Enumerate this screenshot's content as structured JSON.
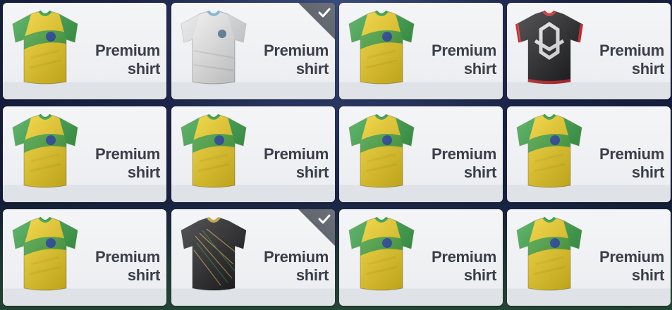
{
  "items": [
    {
      "label1": "Premium",
      "label2": "shirt",
      "kit": "brazil",
      "selected": false
    },
    {
      "label1": "Premium",
      "label2": "shirt",
      "kit": "white",
      "selected": true
    },
    {
      "label1": "Premium",
      "label2": "shirt",
      "kit": "brazil",
      "selected": false
    },
    {
      "label1": "Premium",
      "label2": "shirt",
      "kit": "black-red",
      "selected": false
    },
    {
      "label1": "Premium",
      "label2": "shirt",
      "kit": "brazil",
      "selected": false
    },
    {
      "label1": "Premium",
      "label2": "shirt",
      "kit": "brazil",
      "selected": false
    },
    {
      "label1": "Premium",
      "label2": "shirt",
      "kit": "brazil",
      "selected": false
    },
    {
      "label1": "Premium",
      "label2": "shirt",
      "kit": "brazil",
      "selected": false
    },
    {
      "label1": "Premium",
      "label2": "shirt",
      "kit": "brazil",
      "selected": false
    },
    {
      "label1": "Premium",
      "label2": "shirt",
      "kit": "black-gold",
      "selected": true
    },
    {
      "label1": "Premium",
      "label2": "shirt",
      "kit": "brazil",
      "selected": false
    },
    {
      "label1": "Premium",
      "label2": "shirt",
      "kit": "brazil",
      "selected": false
    }
  ],
  "colors": {
    "brazil_yellow": "#f4d21a",
    "brazil_green": "#2f9e3e",
    "brazil_blue": "#1c3f94",
    "white_kit": "#f2f2f2",
    "black_kit": "#1e1e22",
    "red_trim": "#d0262c",
    "gold_trim": "#c9a23a",
    "label_text": "#3b3f47",
    "check_bg": "#5f636b"
  }
}
